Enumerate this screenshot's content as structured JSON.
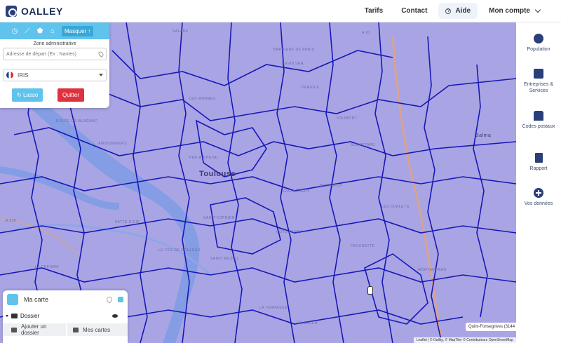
{
  "header": {
    "brand": "OALLEY",
    "nav": {
      "tarifs": "Tarifs",
      "contact": "Contact",
      "aide": "Aide",
      "account": "Mon compte"
    }
  },
  "panel": {
    "toolbar": {
      "hide_label": "Masquer"
    },
    "zone_title": "Zone administrative",
    "address_placeholder": "Adresse de départ (Ex : Nantes)",
    "division": "IRIS",
    "lasso_label": "Lasso",
    "quit_label": "Quitter"
  },
  "sidebar": {
    "items": [
      {
        "label": "Population",
        "icon": "pie-chart-icon"
      },
      {
        "label": "Entreprises & Services",
        "icon": "briefcase-icon"
      },
      {
        "label": "Codes postaux",
        "icon": "mailbox-icon"
      },
      {
        "label": "Rapport",
        "icon": "document-icon"
      },
      {
        "label": "Vos données",
        "icon": "plus-circle-icon"
      }
    ]
  },
  "map": {
    "city": "Toulouse",
    "secondary_city": "Balma",
    "labels": [
      "SALADE",
      "BARRIERE DE PARIS",
      "REVOLVER",
      "PERIOLE",
      "LES MINIMES",
      "ROUTE DE BLAGNAC",
      "AMIDONNIERS",
      "FER-A-CHEVAL",
      "PATTE D'OIE",
      "LE FER DE ROULEAU",
      "LA CEPIERE",
      "SAINT-CYPRIEN",
      "BONNEFOY",
      "GUILHEMERY",
      "COTE PAVEE",
      "JOLIMONT",
      "LES CHALETS",
      "MONTAUDRAN",
      "FAOURETTE",
      "SOUPETARD",
      "LE BUSCA",
      "LA TERRASSE",
      "SAINT MICHEL",
      "A 61",
      "A 620"
    ],
    "commune_tag": "Quint-Fonsegrives (3144",
    "attribution": "Leaflet | © Oalley, © MapTiler © Contributeurs OpenStreetMap"
  },
  "my_map": {
    "title": "Ma carte",
    "folder": "Dossier",
    "add_folder": "Ajouter un dossier",
    "my_maps": "Mes cartes"
  },
  "colors": {
    "brand": "#2a3f7a",
    "accent": "#5fc3ec",
    "danger": "#e0323e",
    "overlay": "#a9a5e4",
    "boundary": "#1818b8"
  }
}
